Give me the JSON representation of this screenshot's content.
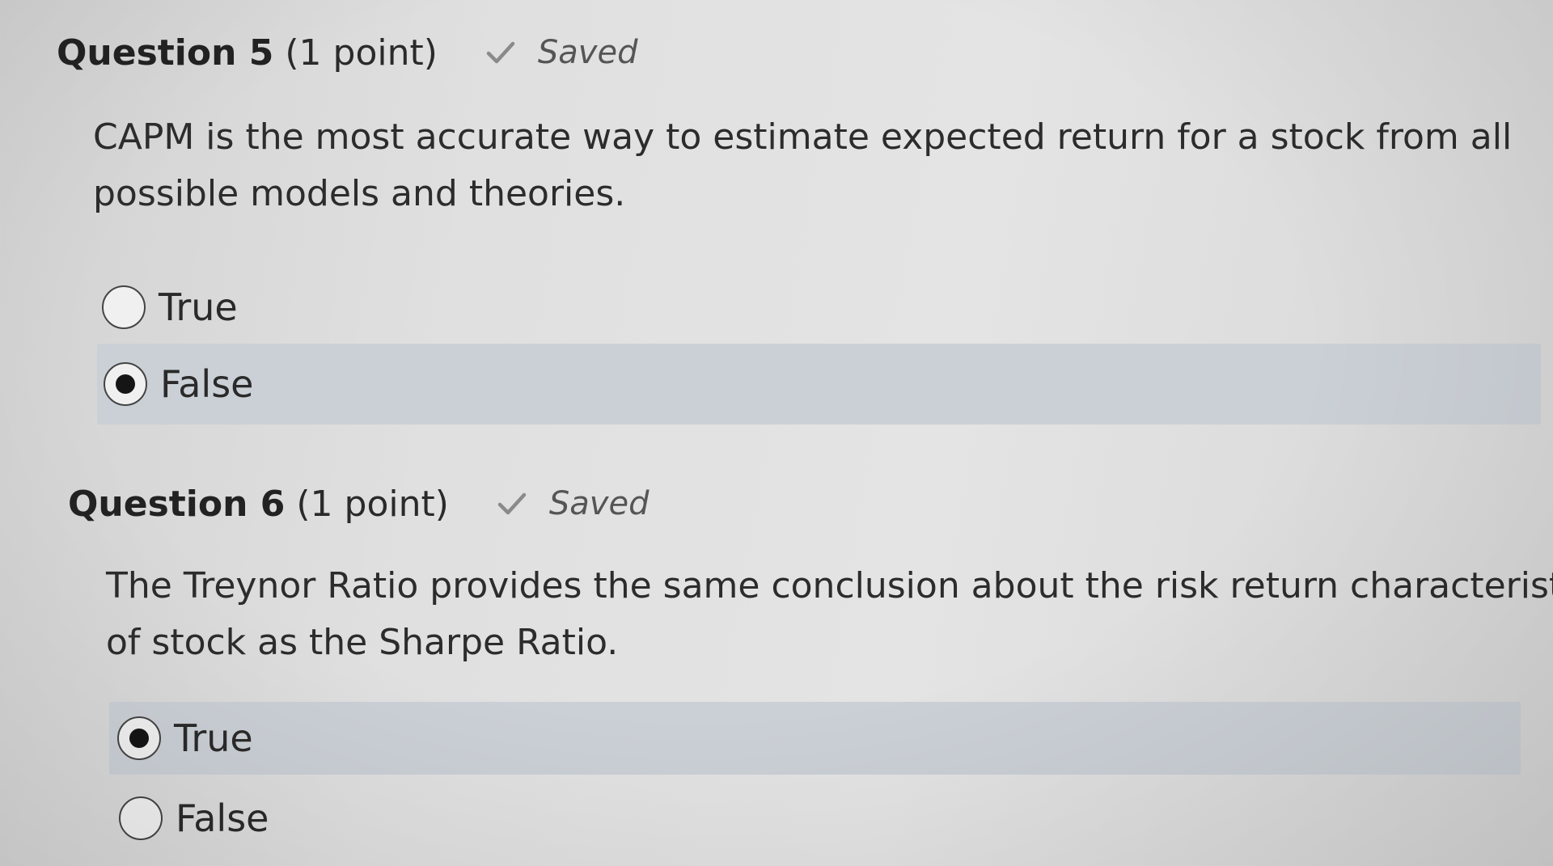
{
  "questions": [
    {
      "title": "Question 5",
      "points": "(1 point)",
      "status": "Saved",
      "status_icon": "check-icon",
      "text_lines": [
        "CAPM is the most accurate way to estimate expected return for a stock from all",
        "possible models and theories."
      ],
      "choices": [
        {
          "label": "True",
          "selected": false
        },
        {
          "label": "False",
          "selected": true
        }
      ]
    },
    {
      "title": "Question 6",
      "points": "(1 point)",
      "status": "Saved",
      "status_icon": "check-icon",
      "text_lines": [
        "The Treynor Ratio provides the same conclusion about the risk return characteristics",
        "of stock as the Sharpe Ratio."
      ],
      "choices": [
        {
          "label": "True",
          "selected": true
        },
        {
          "label": "False",
          "selected": false
        }
      ]
    }
  ],
  "colors": {
    "selected_row": "#cbd0d6",
    "check": "#8a8a8a"
  }
}
